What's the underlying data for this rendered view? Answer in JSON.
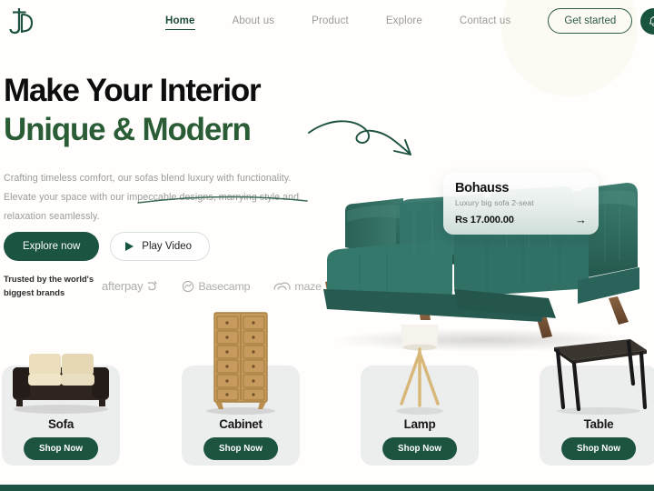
{
  "brand": {
    "logo_icon": "jd-monogram-logo",
    "accent_green": "#1c5440",
    "heading_green": "#2a5d36",
    "muted_gray": "#9b9b9b",
    "card_gray": "#eceded"
  },
  "nav": {
    "links": [
      {
        "label": "Home",
        "active": true
      },
      {
        "label": "About us",
        "active": false
      },
      {
        "label": "Product",
        "active": false
      },
      {
        "label": "Explore",
        "active": false
      },
      {
        "label": "Contact us",
        "active": false
      }
    ],
    "get_started_label": "Get started",
    "bell_icon": "bell-icon"
  },
  "hero": {
    "heading_line1": "Make Your Interior",
    "heading_line2": "Unique & Modern",
    "paragraph": "Crafting timeless comfort, our sofas blend luxury with functionality. Elevate your space with our impeccable designs, marrying style and  relaxation seamlessly.",
    "explore_label": "Explore now",
    "play_label": "Play Video",
    "play_icon": "play-triangle-icon",
    "arrow_icon": "curved-arrow-icon",
    "swoosh_icon": "underline-swoosh-icon"
  },
  "trusted": {
    "label_line1": "Trusted by the world's",
    "label_line2": "biggest brands",
    "brands": [
      {
        "name": "afterpay",
        "icon": "afterpay-swirl-icon"
      },
      {
        "name": "Basecamp",
        "icon": "basecamp-circle-icon"
      },
      {
        "name": "maze",
        "icon": "maze-arc-icon"
      }
    ]
  },
  "product_card": {
    "title": "Bohauss",
    "subtitle": "Luxury big sofa 2-seat",
    "price": "Rs 17.000.00",
    "arrow_icon": "arrow-right-icon",
    "image_alt": "green-velvet-sofa"
  },
  "categories": [
    {
      "name": "Sofa",
      "button_label": "Shop Now",
      "image": "sofa-thumbnail"
    },
    {
      "name": "Cabinet",
      "button_label": "Shop Now",
      "image": "cabinet-thumbnail"
    },
    {
      "name": "Lamp",
      "button_label": "Shop Now",
      "image": "lamp-thumbnail"
    },
    {
      "name": "Table",
      "button_label": "Shop Now",
      "image": "table-thumbnail"
    }
  ]
}
